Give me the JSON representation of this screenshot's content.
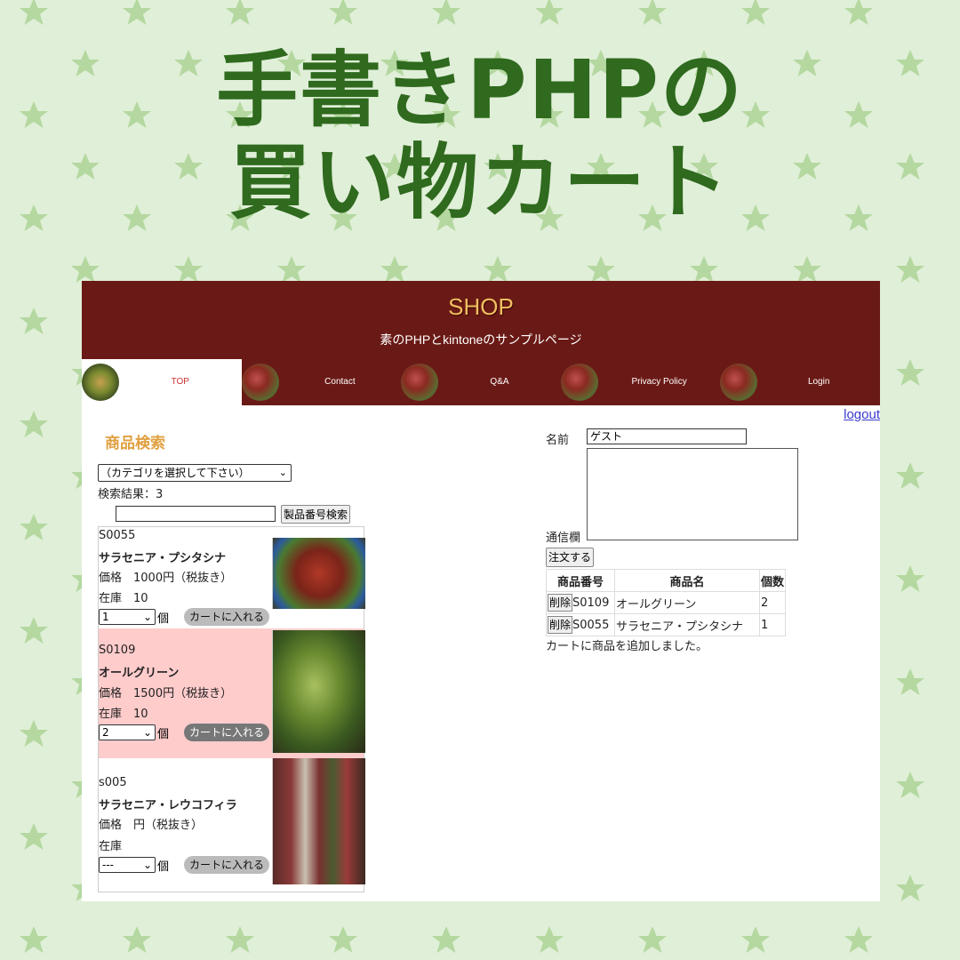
{
  "banner": {
    "line1": "手書きPHPの",
    "line2": "買い物カート"
  },
  "colors": {
    "background": "#e0efd8",
    "star": "#b4d8a0",
    "banner_text": "#2f6a1e",
    "header": "#6a1a16",
    "highlight_row": "#ffcccc"
  },
  "header": {
    "title": "SHOP",
    "subtitle": "素のPHPとkintoneのサンプルページ"
  },
  "nav": {
    "items": [
      {
        "label": "TOP"
      },
      {
        "label": "Contact"
      },
      {
        "label": "Q&A"
      },
      {
        "label": "Privacy Policy"
      },
      {
        "label": "Login"
      }
    ]
  },
  "logout_label": "logout",
  "search": {
    "heading": "商品検索",
    "category_selected": "（カテゴリを選択して下さい）",
    "result_text": "検索結果：3",
    "search_value": "",
    "search_button": "製品番号検索"
  },
  "products": [
    {
      "code": "S0055",
      "name": "サラセニア・プシタシナ",
      "price": "価格　1000円（税抜き）",
      "stock": "在庫　10",
      "qty": "1",
      "unit": "個",
      "button": "カートに入れる"
    },
    {
      "code": "S0109",
      "name": "オールグリーン",
      "price": "価格　1500円（税抜き）",
      "stock": "在庫　10",
      "qty": "2",
      "unit": "個",
      "button": "カートに入れる"
    },
    {
      "code": "s005",
      "name": "サラセニア・レウコフィラ",
      "price": "価格　円（税抜き）",
      "stock": "在庫",
      "qty": "---",
      "unit": "個",
      "button": "カートに入れる"
    }
  ],
  "order": {
    "name_label": "名前",
    "name_value": "ゲスト",
    "memo_label": "通信欄",
    "submit": "注文する"
  },
  "cart": {
    "headers": [
      "商品番号",
      "商品名",
      "個数"
    ],
    "delete_label": "削除",
    "rows": [
      {
        "code": "S0109",
        "name": "オールグリーン",
        "qty": "2"
      },
      {
        "code": "S0055",
        "name": "サラセニア・プシタシナ",
        "qty": "1"
      }
    ],
    "message": "カートに商品を追加しました。"
  }
}
